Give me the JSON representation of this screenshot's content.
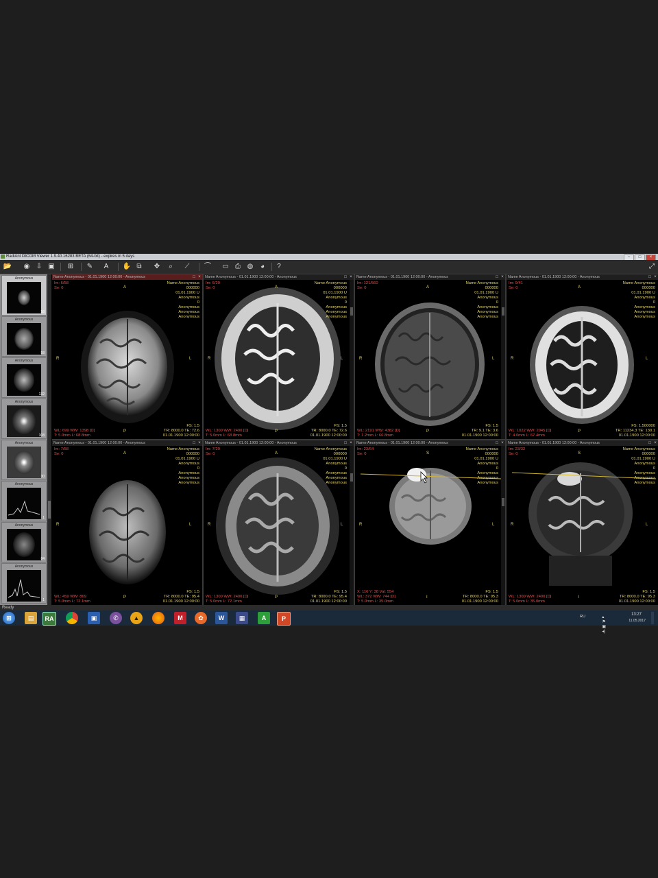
{
  "window": {
    "title": "RadiAnt DICOM Viewer 1.9.40.16283 BETA (64-bit) - expires in 5 days"
  },
  "thumbnails": {
    "header": "Anonymous",
    "items": [
      {
        "label": "Anonymous",
        "count": "58"
      },
      {
        "label": "Anonymous",
        "count": "58"
      },
      {
        "label": "Anonymous",
        "count": "132"
      },
      {
        "label": "Anonymous",
        "count": "108"
      },
      {
        "label": "Anonymous",
        "count": "30"
      },
      {
        "label": "Anonymous",
        "count": "1"
      },
      {
        "label": "Anonymous",
        "count": "84"
      },
      {
        "label": "Anonymous",
        "count": "1"
      }
    ]
  },
  "panels": [
    {
      "header": "Name Anonymous - 01.01.1900 12:00:00 - Anonymous",
      "im": "Im: 6/58",
      "se": "Se: 0",
      "info": [
        "Name Anonymous",
        "000000",
        "01.01.1900 U",
        "Anonymous",
        "0",
        "Anonymous",
        "Anonymous",
        "Anonymous"
      ],
      "wl": "WL: 699 WW: 1398 [D]",
      "thick": "T: 5.0mm L: 68.8mm",
      "fs": "FS: 1.5",
      "tr": "TR: 8000.0 TE: 72.6",
      "date": "01.01.1900 12:00:00",
      "o_top": "A",
      "o_bottom": "P",
      "o_left": "R",
      "o_right": "L"
    },
    {
      "header": "Name Anonymous - 01.01.1900 12:00:00 - Anonymous",
      "im": "Im: 6/29",
      "se": "Se: 0",
      "info": [
        "Name Anonymous",
        "000000",
        "01.01.1900 U",
        "Anonymous",
        "0",
        "Anonymous",
        "Anonymous",
        "Anonymous"
      ],
      "wl": "WL: 1300 WW: 2400 [D]",
      "thick": "T: 5.0mm L: 68.8mm",
      "fs": "FS: 1.5",
      "tr": "TR: 8000.0 TE: 72.6",
      "date": "01.01.1900 12:00:00",
      "o_top": "A",
      "o_bottom": "P",
      "o_left": "R",
      "o_right": "L"
    },
    {
      "header": "Name Anonymous - 01.01.1900 12:00:00 - Anonymous",
      "im": "Im: 121/560",
      "se": "Se: 0",
      "info": [
        "Name Anonymous",
        "000000",
        "01.01.1900 U",
        "Anonymous",
        "0",
        "Anonymous",
        "Anonymous",
        "Anonymous"
      ],
      "wl": "WL: 2191 WW: 4382 [D]",
      "thick": "T: 1.2mm L: 66.8mm",
      "fs": "FS: 1.5",
      "tr": "TR: 9.1 TE: 3.6",
      "date": "01.01.1900 12:00:00",
      "o_top": "A",
      "o_bottom": "P",
      "o_left": "R",
      "o_right": "L"
    },
    {
      "header": "Name Anonymous - 01.01.1900 12:00:00 - Anonymous",
      "im": "Im: 9/41",
      "se": "Se: 0",
      "info": [
        "Name Anonymous",
        "000000",
        "01.01.1900 U",
        "Anonymous",
        "0",
        "Anonymous",
        "Anonymous",
        "Anonymous"
      ],
      "wl": "WL: 1022 WW: 2045 [D]",
      "thick": "T: 4.0mm L: 67.4mm",
      "fs": "FS: 1.500000",
      "tr": "TR: 11234.3 TE: 130.1",
      "date": "01.01.1900 12:00:00",
      "o_top": "A",
      "o_bottom": "P",
      "o_left": "R",
      "o_right": "L"
    },
    {
      "header": "Name Anonymous - 01.01.1900 12:00:00 - Anonymous",
      "im": "Im: 7/58",
      "se": "Se: 0",
      "info": [
        "Name Anonymous",
        "000000",
        "01.01.1900 U",
        "Anonymous",
        "0",
        "Anonymous",
        "Anonymous",
        "Anonymous"
      ],
      "wl": "WL: 459 WW: 869",
      "thick": "T: 5.0mm L: 72.1mm",
      "fs": "FS: 1.5",
      "tr": "TR: 8000.0 TE: 95.4",
      "date": "01.01.1900 12:00:00",
      "o_top": "A",
      "o_bottom": "P",
      "o_left": "R",
      "o_right": "L"
    },
    {
      "header": "Name Anonymous - 01.01.1900 12:00:00 - Anonymous",
      "im": "Im: 7/29",
      "se": "Se: 0",
      "info": [
        "Name Anonymous",
        "000000",
        "01.01.1900 U",
        "Anonymous",
        "0",
        "Anonymous",
        "Anonymous",
        "Anonymous"
      ],
      "wl": "WL: 1300 WW: 2400 [D]",
      "thick": "T: 5.0mm L: 72.1mm",
      "fs": "FS: 1.5",
      "tr": "TR: 8000.0 TE: 95.4",
      "date": "01.01.1900 12:00:00",
      "o_top": "A",
      "o_bottom": "P",
      "o_left": "R",
      "o_right": "L"
    },
    {
      "header": "Name Anonymous - 01.01.1900 12:00:00 - Anonymous",
      "im": "Im: 23/64",
      "se": "Se: 0",
      "info": [
        "Name Anonymous",
        "000000",
        "01.01.1900 U",
        "Anonymous",
        "0",
        "Anonymous",
        "Anonymous",
        "Anonymous"
      ],
      "pixel": "X: 116 Y: 38 Val: 554",
      "wl": "WL: 372 WW: 744 [D]",
      "thick": "T: 5.0mm L: 35.0mm",
      "fs": "FS: 1.5",
      "tr": "TR: 8000.0 TE: 95.3",
      "date": "01.01.1900 12:00:00",
      "o_top": "S",
      "o_bottom": "I",
      "o_left": "R",
      "o_right": "L"
    },
    {
      "header": "Name Anonymous - 01.01.1900 12:00:00 - Anonymous",
      "im": "Im: 23/32",
      "se": "Se: 0",
      "info": [
        "Name Anonymous",
        "000000",
        "01.01.1900 U",
        "Anonymous",
        "0",
        "Anonymous",
        "Anonymous",
        "Anonymous"
      ],
      "wl": "WL: 1300 WW: 2400 [D]",
      "thick": "T: 5.0mm L: 35.0mm",
      "fs": "FS: 1.5",
      "tr": "TR: 8000.0 TE: 95.3",
      "date": "01.01.1900 12:00:00",
      "o_top": "S",
      "o_bottom": "I",
      "o_left": "R",
      "o_right": "L"
    }
  ],
  "status": "Ready",
  "taskbar": {
    "lang": "RU",
    "time": "13:27",
    "date": "11.05.2017",
    "apps": [
      "start",
      "explorer",
      "radiant-dicom",
      "chrome",
      "save",
      "viber",
      "aimp",
      "firefox",
      "manager",
      "paint",
      "word",
      "library",
      "access",
      "powerpoint"
    ]
  },
  "colors": {
    "active_header": "#5a1d1d",
    "overlay_red": "#e05050",
    "overlay_yellow": "#e3d36a",
    "taskbar": "#1b2a3b"
  }
}
